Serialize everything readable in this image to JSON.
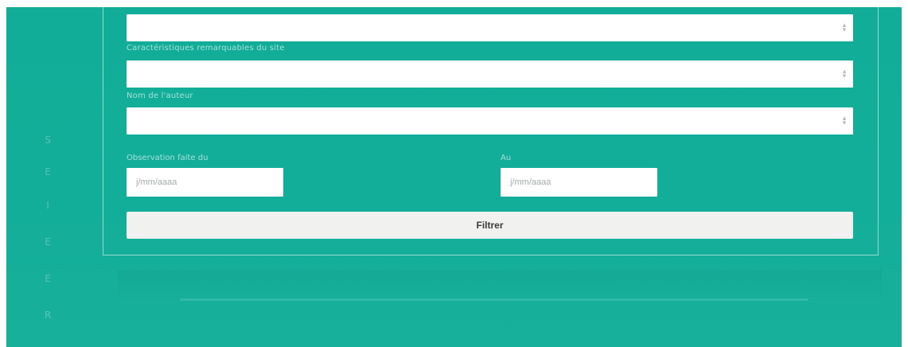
{
  "side_letters": [
    "S",
    "E",
    "I",
    "E",
    "E",
    "R"
  ],
  "form": {
    "select_top_value": "",
    "label_characteristics": "Caractéristiques remarquables du site",
    "select_characteristics_value": "",
    "label_author": "Nom de l'auteur",
    "select_author_value": "",
    "label_date_from": "Observation faite du",
    "date_from_placeholder": "j/mm/aaaa",
    "label_date_to": "Au",
    "date_to_placeholder": "j/mm/aaaa",
    "filter_button_label": "Filtrer"
  },
  "colors": {
    "background": "#12ad98",
    "field": "#ffffff",
    "button": "#f1f1ef"
  },
  "icons": {
    "select_arrow": "chevron-down-icon"
  }
}
